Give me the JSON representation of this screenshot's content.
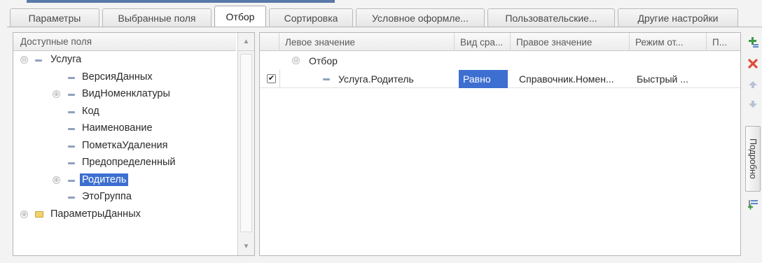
{
  "tabs": [
    {
      "label": "Параметры",
      "active": false
    },
    {
      "label": "Выбранные поля",
      "active": false
    },
    {
      "label": "Отбор",
      "active": true
    },
    {
      "label": "Сортировка",
      "active": false
    },
    {
      "label": "Условное оформле...",
      "active": false
    },
    {
      "label": "Пользовательские...",
      "active": false
    },
    {
      "label": "Другие настройки",
      "active": false
    }
  ],
  "available_fields": {
    "header": "Доступные поля",
    "items": [
      {
        "label": "Услуга",
        "expander": "⊖",
        "icon": "dash-icon"
      },
      {
        "label": "ВерсияДанных",
        "icon": "dash-icon"
      },
      {
        "label": "ВидНоменклатуры",
        "expander": "⊕",
        "icon": "dash-icon"
      },
      {
        "label": "Код",
        "icon": "dash-icon"
      },
      {
        "label": "Наименование",
        "icon": "dash-icon"
      },
      {
        "label": "ПометкаУдаления",
        "icon": "dash-icon"
      },
      {
        "label": "Предопределенный",
        "icon": "dash-icon"
      },
      {
        "label": "Родитель",
        "expander": "⊕",
        "icon": "dash-icon",
        "selected": true
      },
      {
        "label": "ЭтоГруппа",
        "icon": "dash-icon"
      },
      {
        "label": "ПараметрыДанных",
        "expander": "⊕",
        "icon": "folder-icon"
      }
    ]
  },
  "filter_grid": {
    "columns": [
      "Левое значение",
      "Вид сра...",
      "Правое значение",
      "Режим от...",
      "П..."
    ],
    "group_row": {
      "expander": "⊖",
      "label": "Отбор"
    },
    "rows": [
      {
        "checked": true,
        "check_mark": "✔",
        "left_value": "Услуга.Родитель",
        "comparison": "Равно",
        "right_value": "Справочник.Номен...",
        "mode": "Быстрый ...",
        "p": ""
      }
    ]
  },
  "toolbar": {
    "add_icon": "add-condition-icon",
    "delete_icon": "delete-icon",
    "move_up_icon": "move-up-icon",
    "move_down_icon": "move-down-icon",
    "group_icon": "group-conditions-icon",
    "details_label": "Подробно"
  },
  "colors": {
    "selection": "#3d6fd1",
    "delete": "#e04b3a",
    "add": "#3f9a43"
  }
}
